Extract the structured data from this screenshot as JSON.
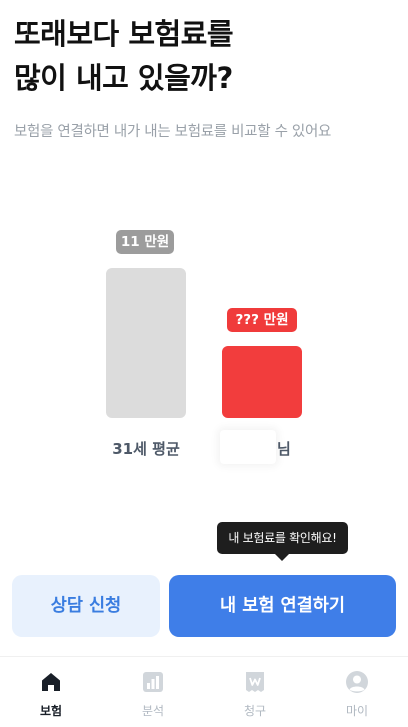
{
  "headline": {
    "line1": "또래보다 보험료를",
    "line2": "많이 내고 있을까?"
  },
  "subtitle": "보험을 연결하면 내가 내는 보험료를 비교할 수 있어요",
  "comparison": {
    "average": {
      "value_label": "11 만원",
      "caption": "31세 평균",
      "bar_color": "#dcdcdc",
      "pill_color": "#9c9c9c"
    },
    "me": {
      "value_label": "??? 만원",
      "caption_suffix": "님",
      "bar_color": "#f23d3d",
      "pill_color": "#f03b3b"
    }
  },
  "tooltip": "내 보험료를 확인해요!",
  "buttons": {
    "consult": "상담 신청",
    "connect": "내 보험 연결하기"
  },
  "tabs": [
    {
      "label": "보험",
      "icon": "home-icon",
      "active": true
    },
    {
      "label": "분석",
      "icon": "chart-icon",
      "active": false
    },
    {
      "label": "청구",
      "icon": "receipt-icon",
      "active": false
    },
    {
      "label": "마이",
      "icon": "profile-icon",
      "active": false
    }
  ],
  "colors": {
    "accent": "#3f7ee8",
    "accent_light": "#e8f1fd",
    "danger": "#f23d3d"
  }
}
